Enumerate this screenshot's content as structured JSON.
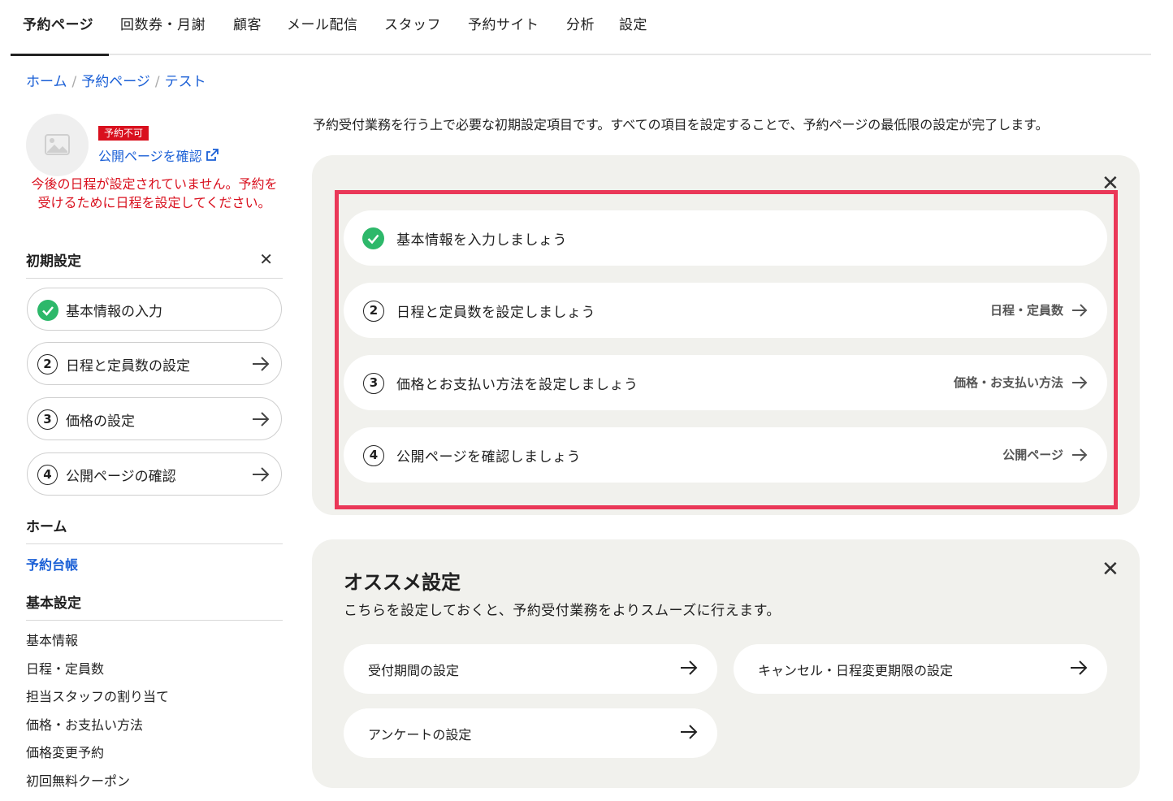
{
  "nav": {
    "tabs": [
      "予約ページ",
      "回数券・月謝",
      "顧客",
      "メール配信",
      "スタッフ",
      "予約サイト",
      "分析",
      "設定"
    ]
  },
  "breadcrumb": [
    "ホーム",
    "予約ページ",
    "テスト"
  ],
  "sidebar": {
    "badge": "予約不可",
    "public_link": "公開ページを確認",
    "warning": "今後の日程が設定されていません。予約を受けるために日程を設定してください。",
    "initial_setup_title": "初期設定",
    "steps": [
      {
        "num": "",
        "label": "基本情報の入力",
        "done": true
      },
      {
        "num": "2",
        "label": "日程と定員数の設定",
        "done": false
      },
      {
        "num": "3",
        "label": "価格の設定",
        "done": false
      },
      {
        "num": "4",
        "label": "公開ページの確認",
        "done": false
      }
    ],
    "home_title": "ホーム",
    "home_link": "予約台帳",
    "basic_title": "基本設定",
    "basic_links": [
      "基本情報",
      "日程・定員数",
      "担当スタッフの割り当て",
      "価格・お支払い方法",
      "価格変更予約",
      "初回無料クーポン"
    ]
  },
  "main": {
    "intro": "予約受付業務を行う上で必要な初期設定項目です。すべての項目を設定することで、予約ページの最低限の設定が完了します。",
    "tasks": [
      {
        "num": "",
        "title": "基本情報を入力しましょう",
        "link": "",
        "done": true
      },
      {
        "num": "2",
        "title": "日程と定員数を設定しましょう",
        "link": "日程・定員数",
        "done": false
      },
      {
        "num": "3",
        "title": "価格とお支払い方法を設定しましょう",
        "link": "価格・お支払い方法",
        "done": false
      },
      {
        "num": "4",
        "title": "公開ページを確認しましょう",
        "link": "公開ページ",
        "done": false
      }
    ],
    "recommend": {
      "title": "オススメ設定",
      "desc": "こちらを設定しておくと、予約受付業務をよりスムーズに行えます。",
      "buttons": [
        "受付期間の設定",
        "キャンセル・日程変更期限の設定",
        "アンケートの設定"
      ]
    }
  },
  "colors": {
    "accent_blue": "#1a5fd6",
    "danger": "#d9101e",
    "success": "#2db86a",
    "highlight": "#ea3858"
  }
}
